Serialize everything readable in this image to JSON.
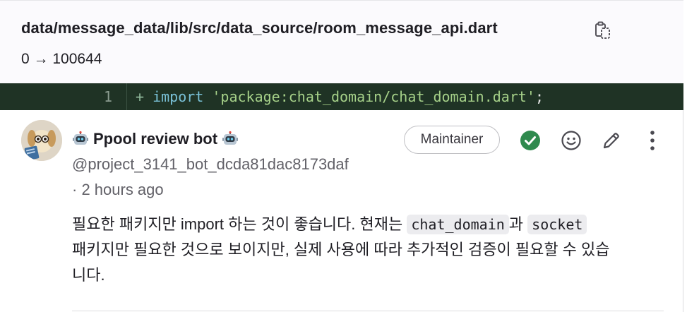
{
  "file": {
    "path": "data/message_data/lib/src/data_source/room_message_api.dart",
    "mode_change": "0 → 100644",
    "copy_icon": "copy-icon"
  },
  "diff": {
    "line_number": "1",
    "marker": "+",
    "keyword": "import",
    "string": "'package:chat_domain/chat_domain.dart'",
    "terminator": ";"
  },
  "note": {
    "author_name": "Ppool review bot",
    "author_handle": "@project_3141_bot_dcda81dac8173daf",
    "timestamp": "· 2 hours ago",
    "role_badge": "Maintainer",
    "actions": [
      "resolved-check-icon",
      "emoji-icon",
      "edit-pencil-icon",
      "more-vertical-icon"
    ],
    "body": {
      "part1": "필요한 패키지만 import 하는 것이 좋습니다. 현재는 ",
      "code1": "chat_domain",
      "part2": "과 ",
      "code2": "socket",
      "line2": "패키지만 필요한 것으로 보이지만, 실제 사용에 따라 추가적인 검증이 필요할 수 있습",
      "line3": "니다."
    }
  },
  "colors": {
    "diff_added_bg": "#1f3325",
    "resolved_green": "#2f8a4e",
    "string_green": "#a6d189",
    "keyword_blue": "#79c0d6"
  }
}
